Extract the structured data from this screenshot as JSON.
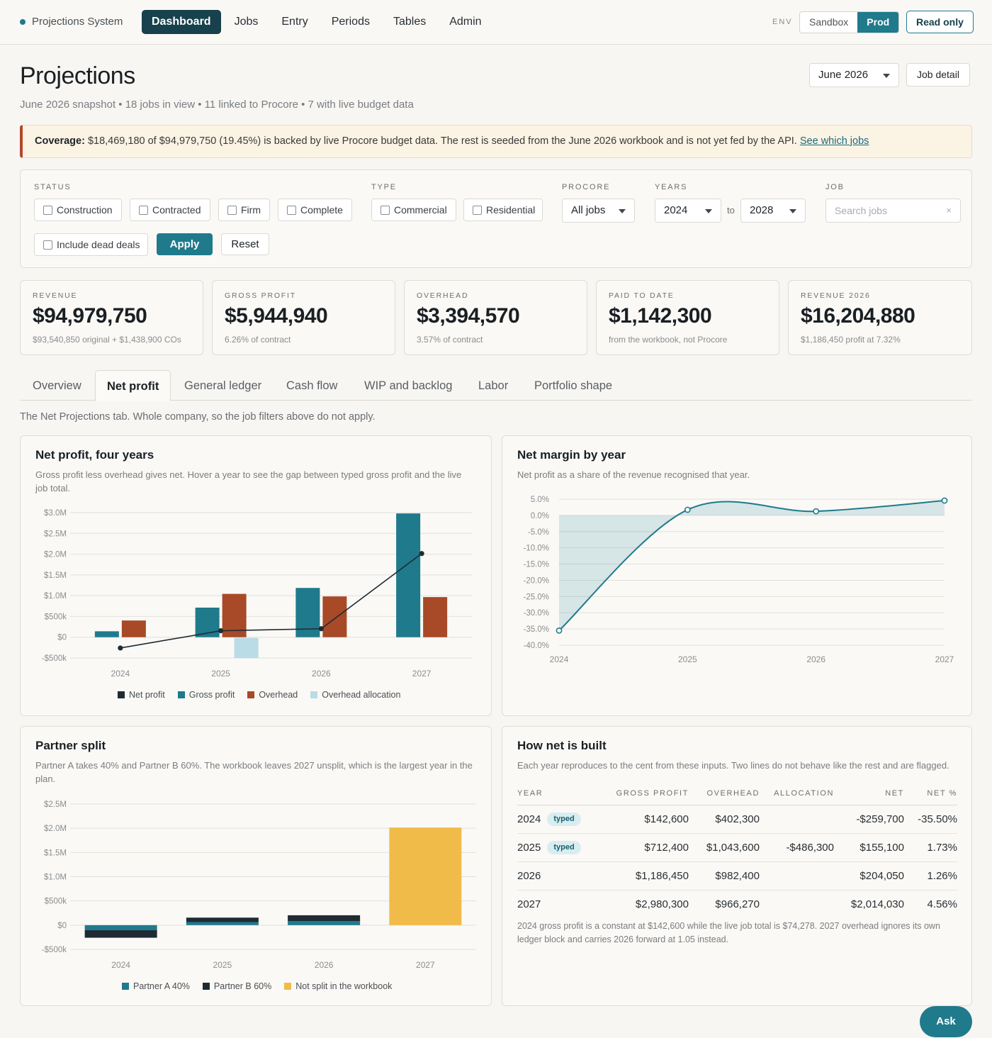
{
  "nav": {
    "brand": "Projections System",
    "items": [
      "Dashboard",
      "Jobs",
      "Entry",
      "Periods",
      "Tables",
      "Admin"
    ],
    "active": "Dashboard",
    "env_label": "ENV",
    "env_options": [
      "Sandbox",
      "Prod"
    ],
    "env_selected": "Prod",
    "read_only": "Read only"
  },
  "header": {
    "title": "Projections",
    "subtitle": "June 2026 snapshot • 18 jobs in view • 11 linked to Procore • 7 with live budget data",
    "month": "June 2026",
    "job_detail": "Job detail"
  },
  "banner": {
    "label": "Coverage:",
    "text": " $18,469,180 of $94,979,750 (19.45%) is backed by live Procore budget data. The rest is seeded from the June 2026 workbook and is not yet fed by the API. ",
    "link": "See which jobs"
  },
  "filters": {
    "status_label": "STATUS",
    "status": [
      "Construction",
      "Contracted",
      "Firm",
      "Complete"
    ],
    "type_label": "TYPE",
    "type": [
      "Commercial",
      "Residential"
    ],
    "procore_label": "PROCORE",
    "procore_value": "All jobs",
    "years_label": "YEARS",
    "year_from": "2024",
    "year_to_label": "to",
    "year_to": "2028",
    "job_label": "JOB",
    "job_placeholder": "Search jobs",
    "clear": "×",
    "dead_deals": "Include dead deals",
    "apply": "Apply",
    "reset": "Reset"
  },
  "kpis": [
    {
      "label": "REVENUE",
      "value": "$94,979,750",
      "note": "$93,540,850 original + $1,438,900 COs"
    },
    {
      "label": "GROSS PROFIT",
      "value": "$5,944,940",
      "note": "6.26% of contract"
    },
    {
      "label": "OVERHEAD",
      "value": "$3,394,570",
      "note": "3.57% of contract"
    },
    {
      "label": "PAID TO DATE",
      "value": "$1,142,300",
      "note": "from the workbook, not Procore"
    },
    {
      "label": "REVENUE 2026",
      "value": "$16,204,880",
      "note": "$1,186,450 profit at 7.32%"
    }
  ],
  "tabs": [
    "Overview",
    "Net profit",
    "General ledger",
    "Cash flow",
    "WIP and backlog",
    "Labor",
    "Portfolio shape"
  ],
  "active_tab": "Net profit",
  "tab_note": "The Net Projections tab. Whole company, so the job filters above do not apply.",
  "colors": {
    "teal": "#1f7a8c",
    "navy": "#17414c",
    "rust": "#a84a27",
    "lightblue": "#b9dce6",
    "dark": "#1e2b33",
    "gold": "#f0bb48"
  },
  "cards": {
    "net_profit": {
      "title": "Net profit, four years",
      "desc": "Gross profit less overhead gives net. Hover a year to see the gap between typed gross profit and the live job total."
    },
    "net_margin": {
      "title": "Net margin by year",
      "desc": "Net profit as a share of the revenue recognised that year."
    },
    "partner": {
      "title": "Partner split",
      "desc": "Partner A takes 40% and Partner B 60%. The workbook leaves 2027 unsplit, which is the largest year in the plan."
    },
    "how_net": {
      "title": "How net is built",
      "desc": "Each year reproduces to the cent from these inputs. Two lines do not behave like the rest and are flagged.",
      "columns": [
        "YEAR",
        "GROSS PROFIT",
        "OVERHEAD",
        "ALLOCATION",
        "NET",
        "NET %"
      ],
      "typed_badge": "typed",
      "rows": [
        {
          "year": "2024",
          "typed": true,
          "gross": "$142,600",
          "overhead": "$402,300",
          "allocation": "",
          "net": "-$259,700",
          "pct": "-35.50%"
        },
        {
          "year": "2025",
          "typed": true,
          "gross": "$712,400",
          "overhead": "$1,043,600",
          "allocation": "-$486,300",
          "net": "$155,100",
          "pct": "1.73%"
        },
        {
          "year": "2026",
          "typed": false,
          "gross": "$1,186,450",
          "overhead": "$982,400",
          "allocation": "",
          "net": "$204,050",
          "pct": "1.26%"
        },
        {
          "year": "2027",
          "typed": false,
          "gross": "$2,980,300",
          "overhead": "$966,270",
          "allocation": "",
          "net": "$2,014,030",
          "pct": "4.56%"
        }
      ],
      "footnote": "2024 gross profit is a constant at $142,600 while the live job total is $74,278. 2027 overhead ignores its own ledger block and carries 2026 forward at 1.05 instead."
    }
  },
  "ask": "Ask",
  "chart_data": [
    {
      "type": "bar",
      "title": "Net profit, four years",
      "categories": [
        "2024",
        "2025",
        "2026",
        "2027"
      ],
      "ylim": [
        -500000,
        3000000
      ],
      "yticks": [
        3000000,
        2500000,
        2000000,
        1500000,
        1000000,
        500000,
        0,
        -500000
      ],
      "ytick_labels": [
        "$3.0M",
        "$2.5M",
        "$2.0M",
        "$1.5M",
        "$1.0M",
        "$500k",
        "$0",
        "-$500k"
      ],
      "series": [
        {
          "name": "Net profit",
          "kind": "line",
          "values": [
            -259700,
            155100,
            204050,
            2014030
          ]
        },
        {
          "name": "Gross profit",
          "values": [
            142600,
            712400,
            1186450,
            2980300
          ]
        },
        {
          "name": "Overhead",
          "values": [
            402300,
            1043600,
            982400,
            966270
          ]
        },
        {
          "name": "Overhead allocation",
          "values": [
            0,
            -486300,
            0,
            0
          ]
        }
      ]
    },
    {
      "type": "area",
      "title": "Net margin by year",
      "x": [
        "2024",
        "2025",
        "2026",
        "2027"
      ],
      "values": [
        -35.5,
        1.73,
        1.26,
        4.56
      ],
      "ylim": [
        -40,
        5
      ],
      "yticks": [
        5,
        0,
        -5,
        -10,
        -15,
        -20,
        -25,
        -30,
        -35,
        -40
      ],
      "ytick_labels": [
        "5.0%",
        "0.0%",
        "-5.0%",
        "-10.0%",
        "-15.0%",
        "-20.0%",
        "-25.0%",
        "-30.0%",
        "-35.0%",
        "-40.0%"
      ]
    },
    {
      "type": "bar",
      "title": "Partner split",
      "stacked": true,
      "categories": [
        "2024",
        "2025",
        "2026",
        "2027"
      ],
      "ylim": [
        -500000,
        2500000
      ],
      "yticks": [
        2500000,
        2000000,
        1500000,
        1000000,
        500000,
        0,
        -500000
      ],
      "ytick_labels": [
        "$2.5M",
        "$2.0M",
        "$1.5M",
        "$1.0M",
        "$500k",
        "$0",
        "-$500k"
      ],
      "series": [
        {
          "name": "Partner A 40%",
          "values": [
            -103880,
            62040,
            81620,
            0
          ]
        },
        {
          "name": "Partner B 60%",
          "values": [
            -155820,
            93060,
            122430,
            0
          ]
        },
        {
          "name": "Not split in the workbook",
          "values": [
            0,
            0,
            0,
            2014030
          ]
        }
      ]
    }
  ]
}
